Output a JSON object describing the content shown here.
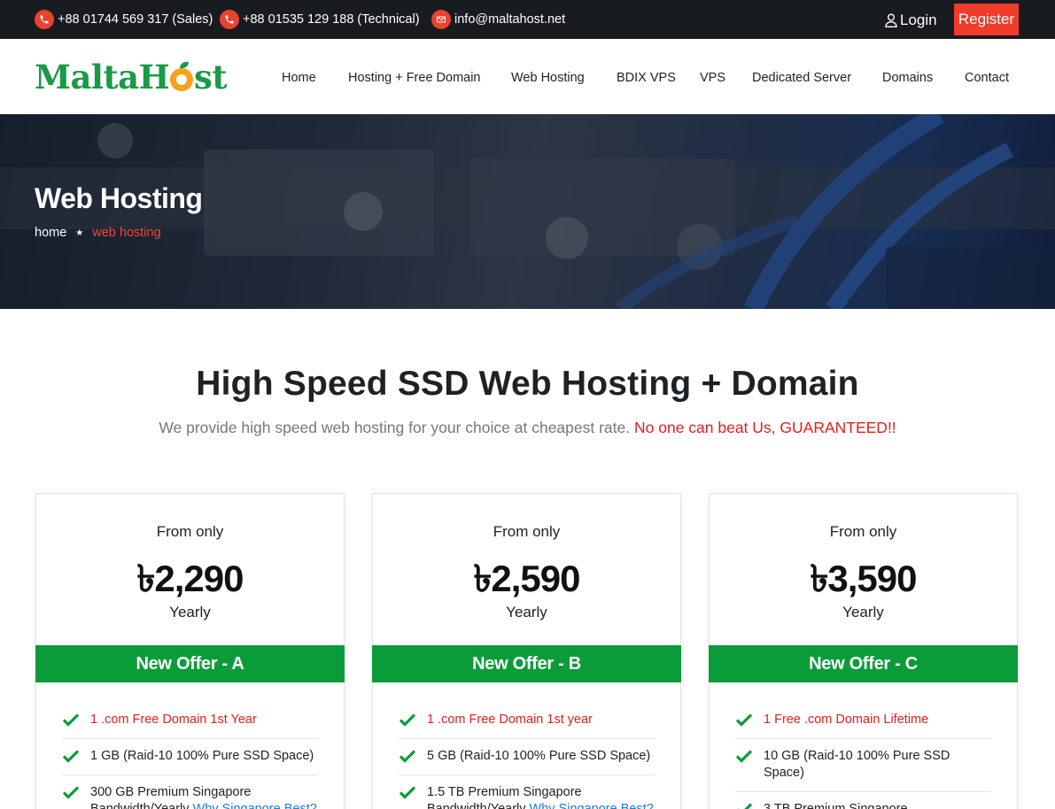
{
  "topbar": {
    "phone_sales": "+88 01744 569 317 (Sales)",
    "phone_technical": "+88 01535 129 188 (Technical)",
    "email": "info@maltahost.net",
    "login_label": "Login",
    "register_label": "Register"
  },
  "logo": {
    "part1": "Malta",
    "part2": "H",
    "part3": "st"
  },
  "nav": [
    "Home",
    "Hosting + Free Domain",
    "Web Hosting",
    "BDIX VPS",
    "VPS",
    "Dedicated Server",
    "Domains",
    "Contact"
  ],
  "hero": {
    "title": "Web Hosting",
    "breadcrumb_home": "home",
    "breadcrumb_current": "web hosting"
  },
  "section": {
    "title": "High Speed SSD Web Hosting + Domain",
    "subtitle": "We provide high speed web hosting for your choice at cheapest rate.",
    "subtitle_highlight": "No one can beat Us, GUARANTEED!!"
  },
  "plans": [
    {
      "from": "From only",
      "price": "৳2,290",
      "period": "Yearly",
      "offer": "New Offer - A",
      "features": [
        "1 .com Free Domain 1st Year",
        "1 GB (Raid-10 100% Pure SSD Space)",
        "300 GB Premium Singapore",
        "Bandwidth/Yearly",
        "Why Singapore Best?"
      ]
    },
    {
      "from": "From only",
      "price": "৳2,590",
      "period": "Yearly",
      "offer": "New Offer - B",
      "features": [
        "1 .com Free Domain 1st year",
        "5 GB (Raid-10 100% Pure SSD Space)",
        "1.5 TB Premium Singapore",
        "Bandwidth/Yearly",
        "Why Singapore Best?"
      ]
    },
    {
      "from": "From only",
      "price": "৳3,590",
      "period": "Yearly",
      "offer": "New Offer - C",
      "features": [
        "1 Free .com Domain Lifetime",
        "10 GB (Raid-10 100% Pure SSD Space)",
        "3 TB Premium Singapore"
      ]
    }
  ],
  "colors": {
    "accent_red": "#f13b2b",
    "brand_green": "#0b9c3a",
    "topbar_bg": "#181b20",
    "link_blue": "#1d7ad8"
  }
}
